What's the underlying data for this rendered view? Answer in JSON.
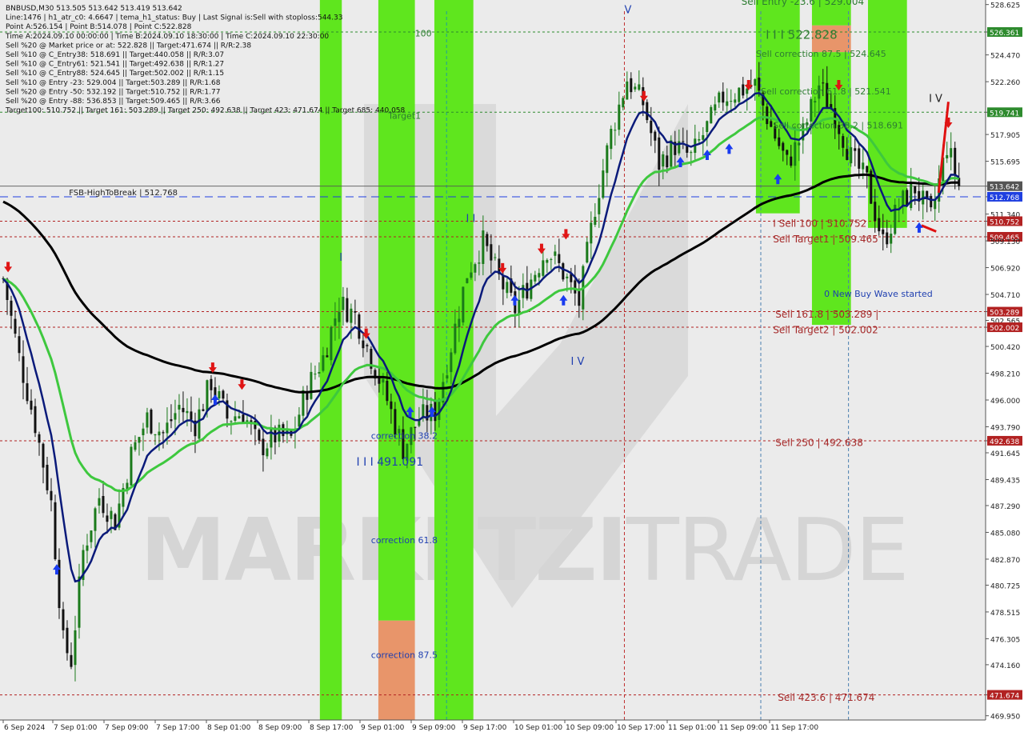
{
  "header": {
    "lines": [
      "BNBUSD,M30  513.505 513.642 513.419 513.642",
      "Line:1476  |  h1_atr_c0: 4.6647  |  tema_h1_status: Buy  |  Last Signal is:Sell with stoploss:544.33",
      "Point A:526.154  |  Point B:514.078  |  Point C:522.828",
      "Time A:2024.09.10 00:00:00  |  Time B:2024.09.10 18:30:00  |  Time C:2024.09.10 22:30:00",
      "Sell %20 @ Market price or at: 522.828  ||  Target:471.674  ||  R/R:2.38",
      "Sell %10 @ C_Entry38: 518.691  ||  Target:440.058  ||  R/R:3.07",
      "Sell %10 @ C_Entry61: 521.541  ||  Target:492.638  ||  R/R:1.27",
      "Sell %10 @ C_Entry88: 524.645  ||  Target:502.002  ||  R/R:1.15",
      "Sell %10 @ Entry -23: 529.004  ||  Target:503.289  ||  R/R:1.68",
      "Sell %20 @ Entry -50: 532.192  ||  Target:510.752  ||  R/R:1.77",
      "Sell %20 @ Entry -88: 536.853  ||  Target:509.465  ||  R/R:3.66",
      "Target100: 510.752  ||  Target 161: 503.289  ||  Target 250: 492.638  ||  Target 423: 471.674  ||  Target 685: 440.058"
    ]
  },
  "watermark": {
    "text_bold": "MARKETZI",
    "text_light": "TRADE"
  },
  "colors": {
    "background": "#ebebeb",
    "green_band": "#5fe61e",
    "orange_band": "#e8956a",
    "bull_candle": "#1a7a1a",
    "bear_candle": "#111111",
    "ema_navy": "#0a1a7a",
    "ema_green": "#3ec83e",
    "ma_black": "#000000",
    "red_level": "#b22222",
    "green_level": "#2e8b2e",
    "blue_level": "#1f3fe0",
    "label_red": "#a52a2a",
    "label_blue": "#1f3fb0",
    "label_green": "#2e7d32"
  },
  "chart_data": {
    "type": "candlestick",
    "symbol": "BNBUSD",
    "timeframe": "M30",
    "ylim": [
      469.6,
      529.0
    ],
    "y_ticks": [
      "528.625",
      "526.361",
      "524.470",
      "522.260",
      "519.741",
      "517.905",
      "515.695",
      "513.642",
      "512.768",
      "511.340",
      "510.752",
      "509.465",
      "509.130",
      "506.920",
      "504.710",
      "503.289",
      "502.565",
      "502.002",
      "500.420",
      "498.210",
      "496.000",
      "493.790",
      "492.638",
      "491.645",
      "489.435",
      "487.290",
      "485.080",
      "482.870",
      "480.725",
      "478.515",
      "476.305",
      "474.160",
      "471.674",
      "469.950"
    ],
    "y_tick_values": [
      528.625,
      526.361,
      524.47,
      522.26,
      519.741,
      517.905,
      515.695,
      513.642,
      512.768,
      511.34,
      510.752,
      509.465,
      509.13,
      506.92,
      504.71,
      503.289,
      502.565,
      502.002,
      500.42,
      498.21,
      496.0,
      493.79,
      492.638,
      491.645,
      489.435,
      487.29,
      485.08,
      482.87,
      480.725,
      478.515,
      476.305,
      474.16,
      471.674,
      469.95
    ],
    "x_ticks": [
      "6 Sep 2024",
      "7 Sep 01:00",
      "7 Sep 09:00",
      "7 Sep 17:00",
      "8 Sep 01:00",
      "8 Sep 09:00",
      "8 Sep 17:00",
      "9 Sep 01:00",
      "9 Sep 09:00",
      "9 Sep 17:00",
      "10 Sep 01:00",
      "10 Sep 09:00",
      "10 Sep 17:00",
      "11 Sep 01:00",
      "11 Sep 09:00",
      "11 Sep 17:00"
    ],
    "x_count": 240,
    "close_series": [
      {
        "i": 0,
        "v": 506.0
      },
      {
        "i": 4,
        "v": 499.5
      },
      {
        "i": 8,
        "v": 494.0
      },
      {
        "i": 12,
        "v": 487.5
      },
      {
        "i": 15,
        "v": 476.0
      },
      {
        "i": 17,
        "v": 474.5
      },
      {
        "i": 20,
        "v": 483.5
      },
      {
        "i": 24,
        "v": 488.0
      },
      {
        "i": 28,
        "v": 486.0
      },
      {
        "i": 32,
        "v": 491.5
      },
      {
        "i": 36,
        "v": 494.5
      },
      {
        "i": 40,
        "v": 493.2
      },
      {
        "i": 44,
        "v": 495.5
      },
      {
        "i": 48,
        "v": 494.0
      },
      {
        "i": 52,
        "v": 497.5
      },
      {
        "i": 56,
        "v": 494.5
      },
      {
        "i": 60,
        "v": 495.0
      },
      {
        "i": 64,
        "v": 492.0
      },
      {
        "i": 68,
        "v": 493.0
      },
      {
        "i": 72,
        "v": 492.8
      },
      {
        "i": 76,
        "v": 497.0
      },
      {
        "i": 80,
        "v": 499.5
      },
      {
        "i": 84,
        "v": 504.0
      },
      {
        "i": 88,
        "v": 503.0
      },
      {
        "i": 92,
        "v": 499.5
      },
      {
        "i": 96,
        "v": 496.0
      },
      {
        "i": 100,
        "v": 492.0
      },
      {
        "i": 104,
        "v": 494.5
      },
      {
        "i": 108,
        "v": 495.0
      },
      {
        "i": 112,
        "v": 500.5
      },
      {
        "i": 116,
        "v": 506.5
      },
      {
        "i": 120,
        "v": 509.0
      },
      {
        "i": 124,
        "v": 506.0
      },
      {
        "i": 128,
        "v": 503.5
      },
      {
        "i": 132,
        "v": 506.0
      },
      {
        "i": 136,
        "v": 508.5
      },
      {
        "i": 140,
        "v": 506.5
      },
      {
        "i": 144,
        "v": 504.0
      },
      {
        "i": 148,
        "v": 512.0
      },
      {
        "i": 152,
        "v": 518.0
      },
      {
        "i": 156,
        "v": 522.5
      },
      {
        "i": 160,
        "v": 520.5
      },
      {
        "i": 164,
        "v": 515.5
      },
      {
        "i": 168,
        "v": 517.0
      },
      {
        "i": 172,
        "v": 516.0
      },
      {
        "i": 176,
        "v": 518.5
      },
      {
        "i": 180,
        "v": 521.0
      },
      {
        "i": 184,
        "v": 521.5
      },
      {
        "i": 188,
        "v": 522.0
      },
      {
        "i": 192,
        "v": 518.5
      },
      {
        "i": 196,
        "v": 515.5
      },
      {
        "i": 200,
        "v": 518.0
      },
      {
        "i": 204,
        "v": 522.0
      },
      {
        "i": 208,
        "v": 519.5
      },
      {
        "i": 212,
        "v": 516.0
      },
      {
        "i": 216,
        "v": 514.0
      },
      {
        "i": 220,
        "v": 509.0
      },
      {
        "i": 224,
        "v": 512.0
      },
      {
        "i": 228,
        "v": 513.5
      },
      {
        "i": 232,
        "v": 511.0
      },
      {
        "i": 236,
        "v": 517.0
      },
      {
        "i": 239,
        "v": 513.642
      }
    ],
    "levels": [
      {
        "value": 526.361,
        "label": "526.361",
        "color": "#2e8b2e",
        "dash": "3,3"
      },
      {
        "value": 519.741,
        "label": "519.741",
        "color": "#2e8b2e",
        "dash": "3,3"
      },
      {
        "value": 513.642,
        "label": "513.642",
        "color": "#555555",
        "dash": ""
      },
      {
        "value": 512.768,
        "label": "512.768",
        "color": "#1f3fe0",
        "dash": "10,6"
      },
      {
        "value": 510.752,
        "label": "510.752",
        "color": "#b22222",
        "dash": "3,3"
      },
      {
        "value": 509.465,
        "label": "509.465",
        "color": "#b22222",
        "dash": "3,3"
      },
      {
        "value": 503.289,
        "label": "503.289",
        "color": "#b22222",
        "dash": "3,3"
      },
      {
        "value": 502.002,
        "label": "502.002",
        "color": "#b22222",
        "dash": "3,3"
      },
      {
        "value": 492.638,
        "label": "492.638",
        "color": "#b22222",
        "dash": "3,3"
      },
      {
        "value": 471.674,
        "label": "471.674",
        "color": "#b22222",
        "dash": "3,3"
      }
    ],
    "bands": [
      {
        "i0": 130,
        "i1": 139,
        "y0": 529.0,
        "y1": 469.6,
        "color": "green"
      },
      {
        "i0": 154,
        "i1": 169,
        "y0": 529.0,
        "y1": 477.8,
        "color": "green"
      },
      {
        "i0": 154,
        "i1": 169,
        "y0": 477.8,
        "y1": 469.6,
        "color": "orange"
      },
      {
        "i0": 177,
        "i1": 193,
        "y0": 529.0,
        "y1": 469.6,
        "color": "green"
      },
      {
        "i0": 309,
        "i1": 327,
        "y0": 529.0,
        "y1": 511.4,
        "color": "green"
      },
      {
        "i0": 332,
        "i1": 348,
        "y0": 529.0,
        "y1": 526.9,
        "color": "green"
      },
      {
        "i0": 332,
        "i1": 348,
        "y0": 526.9,
        "y1": 524.7,
        "color": "orange"
      },
      {
        "i0": 332,
        "i1": 348,
        "y0": 524.7,
        "y1": 502.2,
        "color": "green"
      },
      {
        "i0": 355,
        "i1": 371,
        "y0": 529.0,
        "y1": 510.2,
        "color": "green"
      }
    ],
    "annotations": [
      {
        "text": "Sell Entry -23.6 | 529.004",
        "i": 303,
        "v": 528.6,
        "color": "label_green",
        "size": 12
      },
      {
        "text": "I I I 522.828",
        "i": 313,
        "v": 525.8,
        "color": "label_green",
        "size": 15
      },
      {
        "text": "Sell correction 87.5 | 524.645",
        "i": 309,
        "v": 524.3,
        "color": "label_green",
        "size": 11
      },
      {
        "text": "Sell correction 61.8 | 521.541",
        "i": 311,
        "v": 521.2,
        "color": "label_green",
        "size": 11
      },
      {
        "text": "Sell correction 38.2 | 518.691",
        "i": 316,
        "v": 518.4,
        "color": "label_green",
        "size": 11
      },
      {
        "text": "Target1",
        "i": 158,
        "v": 519.2,
        "color": "label_green",
        "size": 11
      },
      {
        "text": "100",
        "i": 169,
        "v": 526.0,
        "color": "label_green",
        "size": 11
      },
      {
        "text": "FSB-HighToBreak | 512.768",
        "i": 27,
        "v": 512.9,
        "color": "#222222",
        "size": 10
      },
      {
        "text": "I Sell 100 | 510.752",
        "i": 316,
        "v": 510.3,
        "color": "label_red",
        "size": 12
      },
      {
        "text": "Sell Target1 | 509.465",
        "i": 316,
        "v": 509.0,
        "color": "label_red",
        "size": 12
      },
      {
        "text": "0 New Buy Wave started",
        "i": 337,
        "v": 504.5,
        "color": "label_blue",
        "size": 11
      },
      {
        "text": "Sell 161.8 | 503.289 |",
        "i": 317,
        "v": 502.8,
        "color": "label_red",
        "size": 12
      },
      {
        "text": "Sell Target2 | 502.002",
        "i": 316,
        "v": 501.5,
        "color": "label_red",
        "size": 12
      },
      {
        "text": "Sell 250 | 492.638",
        "i": 317,
        "v": 492.2,
        "color": "label_red",
        "size": 12
      },
      {
        "text": "Sell 423.6 | 471.674",
        "i": 318,
        "v": 471.2,
        "color": "label_red",
        "size": 12
      },
      {
        "text": "correction 38.2",
        "i": 151,
        "v": 492.8,
        "color": "label_blue",
        "size": 11
      },
      {
        "text": "I I I 491.091",
        "i": 145,
        "v": 490.6,
        "color": "label_blue",
        "size": 14
      },
      {
        "text": "correction 61.8",
        "i": 151,
        "v": 484.2,
        "color": "label_blue",
        "size": 11
      },
      {
        "text": "correction 87.5",
        "i": 151,
        "v": 474.7,
        "color": "label_blue",
        "size": 11
      },
      {
        "text": "I",
        "i": 138,
        "v": 507.5,
        "color": "label_blue",
        "size": 13
      },
      {
        "text": "I I",
        "i": 190,
        "v": 510.7,
        "color": "label_blue",
        "size": 13
      },
      {
        "text": "I V",
        "i": 233,
        "v": 498.9,
        "color": "label_blue",
        "size": 13
      },
      {
        "text": "V",
        "i": 255,
        "v": 527.9,
        "color": "label_blue",
        "size": 13
      },
      {
        "text": "I V",
        "i": 380,
        "v": 520.6,
        "color": "#222222",
        "size": 13
      }
    ]
  }
}
